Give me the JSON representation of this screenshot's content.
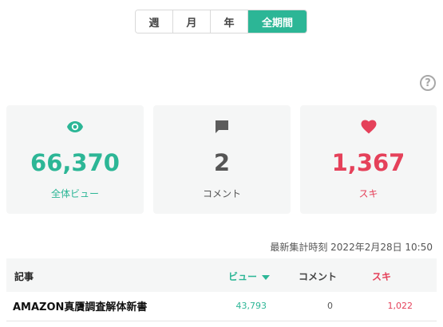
{
  "period": {
    "tabs": [
      {
        "label": "週"
      },
      {
        "label": "月"
      },
      {
        "label": "年"
      },
      {
        "label": "全期間"
      }
    ],
    "active": "全期間"
  },
  "help": {
    "label": "?"
  },
  "stats": {
    "views": {
      "icon": "eye-icon",
      "value": "66,370",
      "label": "全体ビュー"
    },
    "comments": {
      "icon": "comment-icon",
      "value": "2",
      "label": "コメント"
    },
    "likes": {
      "icon": "heart-icon",
      "value": "1,367",
      "label": "スキ"
    }
  },
  "timestamp": "最新集計時刻 2022年2月28日 10:50",
  "table": {
    "headers": {
      "article": "記事",
      "views": "ビュー",
      "comments": "コメント",
      "likes": "スキ"
    },
    "rows": [
      {
        "title": "AMAZON真贋調査解体新書",
        "views": "43,793",
        "comments": "0",
        "likes": "1,022"
      }
    ]
  },
  "colors": {
    "accent": "#2cb696",
    "like": "#e5415a",
    "card_bg": "#f5f6f6"
  }
}
